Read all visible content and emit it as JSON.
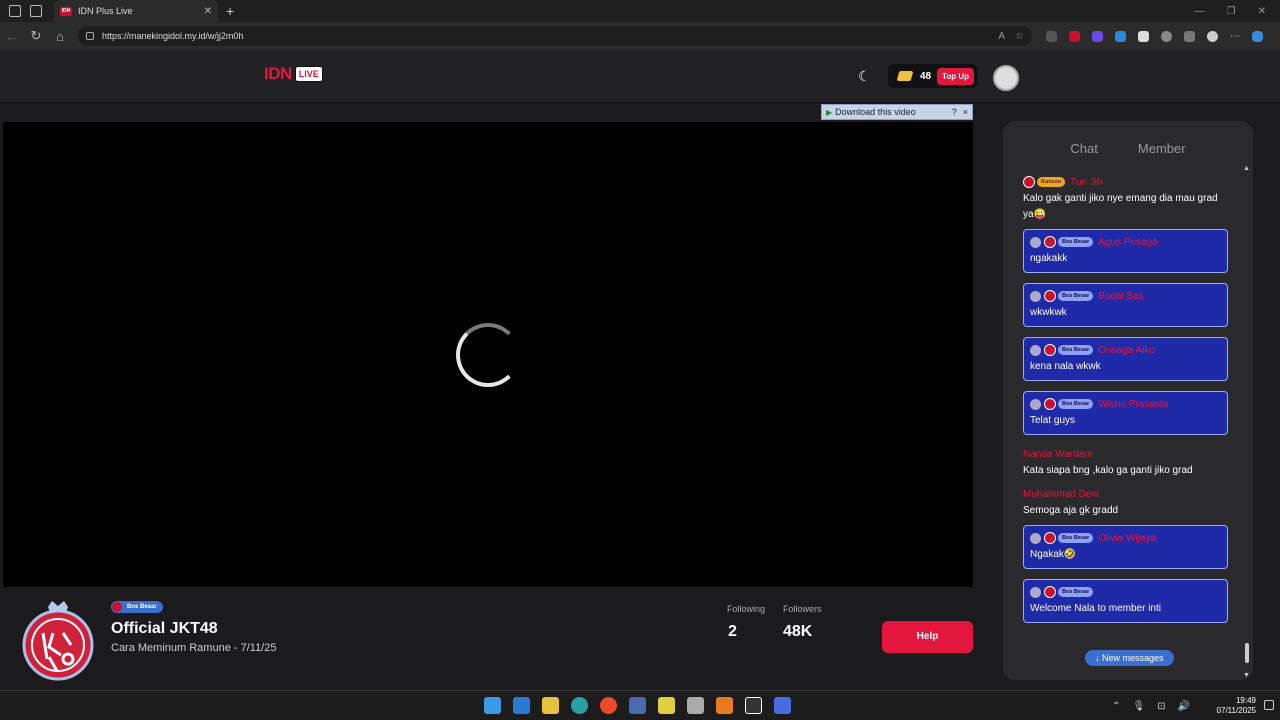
{
  "browser": {
    "tab_title": "IDN Plus Live",
    "favicon_text": "IDN",
    "url": "https://manekingidol.my.id/w/jj2m0h"
  },
  "header": {
    "logo_text": "IDN",
    "logo_badge": "LIVE",
    "coins": "48",
    "topup_label": "Top Up"
  },
  "player": {
    "download_label": "Download this video",
    "download_help": "?",
    "download_close": "×"
  },
  "stream": {
    "badge": "Bos Besar",
    "name": "Official JKT48",
    "subtitle": "Cara Meminum Ramune - 7/11/25",
    "following_label": "Following",
    "following_value": "2",
    "followers_label": "Followers",
    "followers_value": "48K",
    "help_label": "Help"
  },
  "chat": {
    "tabs": [
      "Chat",
      "Member"
    ],
    "messages": [
      {
        "badge": "Kuncen",
        "user": "Tun Jih",
        "text": "Kalo gak ganti jiko nye emang dia mau grad ya😜",
        "boxed": false
      },
      {
        "badge": "Bos Besar",
        "user": "Agus Prisaga",
        "text": "ngakakk",
        "boxed": true
      },
      {
        "badge": "Bos Besar",
        "user": "Bodal Bas",
        "text": "wkwkwk",
        "boxed": true
      },
      {
        "badge": "Bos Besar",
        "user": "Orisaga Aiko",
        "text": "kena nala wkwk",
        "boxed": true
      },
      {
        "badge": "Bos Besar",
        "user": "Wisnu Prasasta",
        "text": "Telat guys",
        "boxed": true
      },
      {
        "badge": "",
        "user": "Nanda Wardani",
        "text": "Kata siapa bng ,kalo ga ganti jiko grad",
        "boxed": false
      },
      {
        "badge": "",
        "user": "Muhammad Deni",
        "text": "Semoga aja gk gradd",
        "boxed": false
      },
      {
        "badge": "Bos Besar",
        "user": "Olivia Wijaya",
        "text": "Ngakak🤣",
        "boxed": true
      },
      {
        "badge": "Bos Besar",
        "user": "",
        "text": "Welcome Nala to member inti",
        "boxed": true
      }
    ],
    "new_messages": "↓ New messages"
  },
  "taskbar": {
    "time": "19:49",
    "date": "07/11/2025"
  },
  "colors": {
    "brand_red": "#e3173e",
    "message_box": "#1e2aa8",
    "badge_blue": "#3a6ed0"
  }
}
